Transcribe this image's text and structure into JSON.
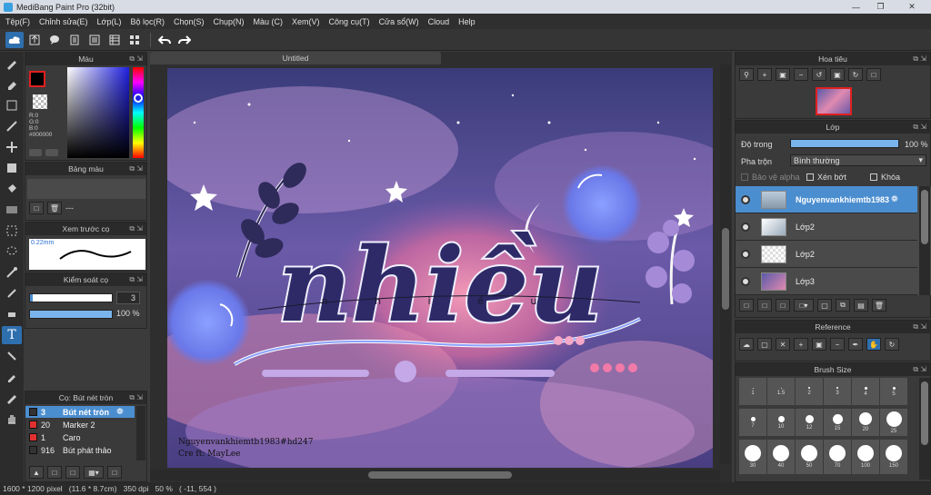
{
  "window": {
    "title": "MediBang Paint Pro (32bit)"
  },
  "menu": [
    "Tệp(F)",
    "Chỉnh sửa(E)",
    "Lớp(L)",
    "Bộ lọc(R)",
    "Chọn(S)",
    "Chụp(N)",
    "Màu (C)",
    "Xem(V)",
    "Công cụ(T)",
    "Cửa sổ(W)",
    "Cloud",
    "Help"
  ],
  "panels": {
    "color": {
      "title": "Màu",
      "r": "R:0",
      "g": "G:0",
      "b": "B:0",
      "hex": "#000000"
    },
    "palette": {
      "title": "Bảng màu",
      "value": "---"
    },
    "preview": {
      "title": "Xem trước cọ",
      "size": "0.22mm"
    },
    "brush_control": {
      "title": "Kiểm soát cọ",
      "size_value": "3",
      "opacity_value": "100 %"
    },
    "brush_list": {
      "title": "Cọ: Bút nét tròn",
      "items": [
        {
          "size": "3",
          "name": "Bút nét tròn",
          "color": "#333333",
          "selected": true
        },
        {
          "size": "20",
          "name": "Marker 2",
          "color": "#e03030",
          "selected": false
        },
        {
          "size": "1",
          "name": "Caro",
          "color": "#e03030",
          "selected": false
        },
        {
          "size": "916",
          "name": "Bút phát thảo",
          "color": "#333333",
          "selected": false
        }
      ]
    },
    "navigator": {
      "title": "Hoa tiêu"
    },
    "layer": {
      "title": "Lớp",
      "opacity_label": "Độ trong",
      "opacity_value": "100 %",
      "blend_label": "Pha trộn",
      "blend_value": "Bình thường",
      "protect_alpha": "Bảo vệ alpha",
      "clip": "Xén bớt",
      "lock": "Khóa",
      "layers": [
        {
          "name": "Nguyenvankhiemtb1983",
          "selected": true
        },
        {
          "name": "Lớp2",
          "selected": false
        },
        {
          "name": "Lớp2",
          "selected": false
        },
        {
          "name": "Lớp3",
          "selected": false
        }
      ]
    },
    "reference": {
      "title": "Reference"
    },
    "brush_size": {
      "title": "Brush Size",
      "sizes": [
        "1",
        "1.5",
        "2",
        "3",
        "4",
        "5",
        "7",
        "10",
        "12",
        "15",
        "20",
        "25",
        "30",
        "40",
        "50",
        "70",
        "100",
        "150"
      ]
    }
  },
  "document": {
    "tab": "Untitled"
  },
  "artwork": {
    "word": "nhiều",
    "subtext": "n h i ề u",
    "credit1": "Nguyenvankhiemtb1983#hd247",
    "credit2": "Cre ft: MayLee"
  },
  "status": {
    "text": "1600 * 1200 pixel   (11.6 * 8.7cm)   350 dpi   50 %   ( -11, 554 )"
  }
}
